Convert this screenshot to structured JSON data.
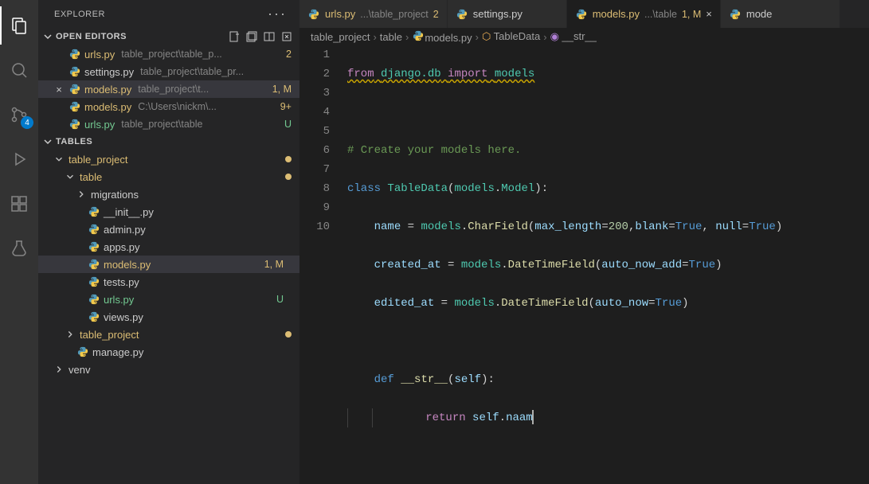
{
  "sidebar_title": "EXPLORER",
  "activity_badge": "4",
  "open_editors": {
    "title": "OPEN EDITORS",
    "items": [
      {
        "name": "urls.py",
        "path": "table_project\\table_p...",
        "status": "2",
        "status_class": "m-brown",
        "close": "",
        "active": false
      },
      {
        "name": "settings.py",
        "path": "table_project\\table_pr...",
        "status": "",
        "status_class": "",
        "close": "",
        "active": false
      },
      {
        "name": "models.py",
        "path": "table_project\\t...",
        "status": "1, M",
        "status_class": "m-brown",
        "close": "×",
        "active": true
      },
      {
        "name": "models.py",
        "path": "C:\\Users\\nickm\\...",
        "status": "9+",
        "status_class": "num-brown",
        "close": "",
        "active": false
      },
      {
        "name": "urls.py",
        "path": "table_project\\table",
        "status": "U",
        "status_class": "u-green",
        "close": "",
        "active": false
      }
    ]
  },
  "folder": {
    "title": "TABLES",
    "tree": [
      {
        "indent": 1,
        "chev": "down",
        "icon": "",
        "name": "table_project",
        "color": "#dcbd74",
        "status": "",
        "dot": true
      },
      {
        "indent": 2,
        "chev": "down",
        "icon": "",
        "name": "table",
        "color": "#dcbd74",
        "status": "",
        "dot": true
      },
      {
        "indent": 3,
        "chev": "right",
        "icon": "",
        "name": "migrations",
        "color": "#cccccc",
        "status": "",
        "dot": false
      },
      {
        "indent": 3,
        "chev": "",
        "icon": "py",
        "name": "__init__.py",
        "color": "#cccccc",
        "status": "",
        "dot": false
      },
      {
        "indent": 3,
        "chev": "",
        "icon": "py",
        "name": "admin.py",
        "color": "#cccccc",
        "status": "",
        "dot": false
      },
      {
        "indent": 3,
        "chev": "",
        "icon": "py",
        "name": "apps.py",
        "color": "#cccccc",
        "status": "",
        "dot": false
      },
      {
        "indent": 3,
        "chev": "",
        "icon": "py",
        "name": "models.py",
        "color": "#dcbd74",
        "status": "1, M",
        "status_class": "m-brown",
        "dot": false,
        "active": true
      },
      {
        "indent": 3,
        "chev": "",
        "icon": "py",
        "name": "tests.py",
        "color": "#cccccc",
        "status": "",
        "dot": false
      },
      {
        "indent": 3,
        "chev": "",
        "icon": "py",
        "name": "urls.py",
        "color": "#73c991",
        "status": "U",
        "status_class": "u-green",
        "dot": false
      },
      {
        "indent": 3,
        "chev": "",
        "icon": "py",
        "name": "views.py",
        "color": "#cccccc",
        "status": "",
        "dot": false
      },
      {
        "indent": 2,
        "chev": "right",
        "icon": "",
        "name": "table_project",
        "color": "#dcbd74",
        "status": "",
        "dot": true
      },
      {
        "indent": 2,
        "chev": "",
        "icon": "py",
        "name": "manage.py",
        "color": "#cccccc",
        "status": "",
        "dot": false
      },
      {
        "indent": 1,
        "chev": "right",
        "icon": "",
        "name": "venv",
        "color": "#cccccc",
        "status": "",
        "dot": false
      }
    ]
  },
  "tabs": [
    {
      "name": "urls.py",
      "path": "...\\table_project",
      "status": "2",
      "status_class": "m-brown",
      "active": false,
      "close": ""
    },
    {
      "name": "settings.py",
      "path": "",
      "status": "",
      "active": false,
      "close": ""
    },
    {
      "name": "models.py",
      "path": "...\\table",
      "status": "1, M",
      "status_class": "m-brown",
      "active": true,
      "close": "×"
    },
    {
      "name": "mode",
      "path": "",
      "status": "",
      "active": false,
      "close": ""
    }
  ],
  "breadcrumb": [
    {
      "text": "table_project",
      "icon": ""
    },
    {
      "text": "table",
      "icon": ""
    },
    {
      "text": "models.py",
      "icon": "py"
    },
    {
      "text": "TableData",
      "icon": "class"
    },
    {
      "text": "__str__",
      "icon": "method"
    }
  ],
  "code": {
    "lines": [
      1,
      2,
      3,
      4,
      5,
      6,
      7,
      8,
      9,
      10
    ],
    "l1_from": "from",
    "l1_mod": "django.db",
    "l1_import": "import",
    "l1_models": "models",
    "l3_comment": "# Create your models here.",
    "l4_class": "class",
    "l4_name": "TableData",
    "l4_par": "(",
    "l4_base": "models",
    "l4_dot": ".",
    "l4_model": "Model",
    "l4_close": "):",
    "l5_indent": "    ",
    "l5_name": "name",
    "l5_eq": " = ",
    "l5_models": "models",
    "l5_dot": ".",
    "l5_field": "CharField",
    "l5_open": "(",
    "l5_p1": "max_length",
    "l5_eq1": "=",
    "l5_v1": "200",
    "l5_c1": ",",
    "l5_p2": "blank",
    "l5_eq2": "=",
    "l5_v2": "True",
    "l5_c2": ", ",
    "l5_p3": "null",
    "l5_eq3": "=",
    "l5_v3": "True",
    "l5_close": ")",
    "l6_indent": "    ",
    "l6_name": "created_at",
    "l6_eq": " = ",
    "l6_models": "models",
    "l6_dot": ".",
    "l6_field": "DateTimeField",
    "l6_open": "(",
    "l6_p1": "auto_now_add",
    "l6_eq1": "=",
    "l6_v1": "True",
    "l6_close": ")",
    "l7_indent": "    ",
    "l7_name": "edited_at",
    "l7_eq": " = ",
    "l7_models": "models",
    "l7_dot": ".",
    "l7_field": "DateTimeField",
    "l7_open": "(",
    "l7_p1": "auto_now",
    "l7_eq1": "=",
    "l7_v1": "True",
    "l7_close": ")",
    "l9_indent": "    ",
    "l9_def": "def",
    "l9_name": "__str__",
    "l9_open": "(",
    "l9_self": "self",
    "l9_close": "):",
    "l10_indent": "        ",
    "l10_return": "return",
    "l10_self": "self",
    "l10_dot": ".",
    "l10_attr": "naam"
  }
}
